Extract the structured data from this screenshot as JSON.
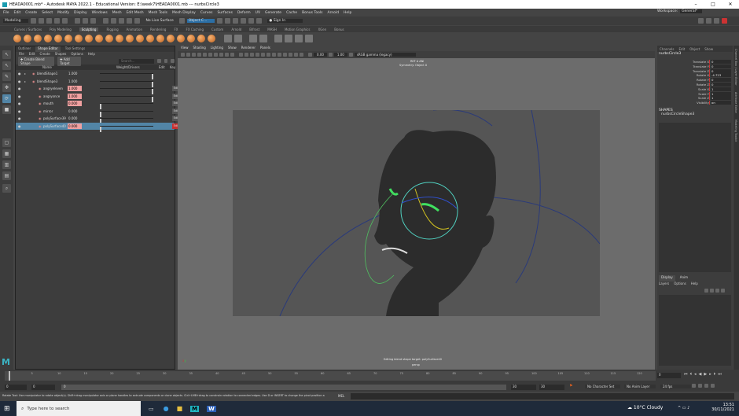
{
  "title": "HEADA0001.mb* - Autodesk MAYA 2022.1 - Educational Version: E:\\week7\\HEADA0001.mb  ---  nurbsCircle3",
  "window_controls": [
    "–",
    "□",
    "✕"
  ],
  "menubar": [
    "File",
    "Edit",
    "Create",
    "Select",
    "Modify",
    "Display",
    "Windows",
    "Mesh",
    "Edit Mesh",
    "Mesh Tools",
    "Mesh Display",
    "Curves",
    "Surfaces",
    "Deform",
    "UV",
    "Generate",
    "Cache",
    "Bonus Tools",
    "Arnold",
    "Help"
  ],
  "workspace": {
    "label": "Workspace:",
    "value": "General*"
  },
  "statusline": {
    "mode": "Modeling",
    "live": "No Live Surface",
    "object": "Object C...",
    "sign_in": "Sign In"
  },
  "shelf_tabs": [
    "Curves / Surfaces",
    "Poly Modeling",
    "Sculpting",
    "Rigging",
    "Animation",
    "Rendering",
    "FX",
    "FX Caching",
    "Custom",
    "Arnold",
    "Bifrost",
    "MASH",
    "Motion Graphics",
    "XGen",
    "Bonus"
  ],
  "shelf_active": "Sculpting",
  "panel_tabs": [
    "Outliner",
    "Shape Editor",
    "Tool Settings"
  ],
  "panel_menu": [
    "File",
    "Edit",
    "Create",
    "Shapes",
    "Options",
    "Help"
  ],
  "shape_editor": {
    "create_btn": "Create Blend Shape",
    "add_btn": "Add Target",
    "search_placeholder": "Search...",
    "cols": {
      "name": "Name",
      "weight": "Weight/Drivers",
      "edit": "Edit",
      "key": "Key"
    },
    "rows": [
      {
        "name": "blendShape1",
        "value": "1.000",
        "indent": 0,
        "style": "plain",
        "handle_fraction": 1.0,
        "edit": "",
        "sel": false,
        "key": false
      },
      {
        "name": "blendShape3",
        "value": "1.000",
        "indent": 0,
        "style": "plain",
        "handle_fraction": 1.0,
        "edit": "",
        "sel": false,
        "key": false
      },
      {
        "name": "angryeleven",
        "value": "1.000",
        "indent": 1,
        "style": "red",
        "handle_fraction": 1.0,
        "edit": "Edit",
        "sel": false,
        "key": true
      },
      {
        "name": "angryonce",
        "value": "1.000",
        "indent": 1,
        "style": "red",
        "handle_fraction": 1.0,
        "edit": "Edit",
        "sel": false,
        "key": true
      },
      {
        "name": "mouth",
        "value": "0.000",
        "indent": 1,
        "style": "red",
        "handle_fraction": 0.0,
        "edit": "Edit",
        "sel": false,
        "key": true
      },
      {
        "name": "mirror",
        "value": "0.000",
        "indent": 1,
        "style": "plain",
        "handle_fraction": 0.0,
        "edit": "Edit",
        "sel": false,
        "key": false
      },
      {
        "name": "polySurface39",
        "value": "0.000",
        "indent": 1,
        "style": "plain",
        "handle_fraction": 0.0,
        "edit": "Edit",
        "sel": false,
        "key": false
      },
      {
        "name": "polySurface40",
        "value": "0.000",
        "indent": 1,
        "style": "red",
        "handle_fraction": 0.0,
        "edit": "Edit",
        "sel": true,
        "key": true
      }
    ]
  },
  "viewport": {
    "menu": [
      "View",
      "Shading",
      "Lighting",
      "Show",
      "Renderer",
      "Panels"
    ],
    "value1": "0.00",
    "value2": "1.00",
    "colorspace": "sRGB gamma (legacy)",
    "hud_top1": "REF A ANI",
    "hud_top2": "Symmetry: Object X",
    "hud_msg": "Editing blend shape target: polySurface40",
    "hud_cam": "persp"
  },
  "channel_box": {
    "tabs": [
      "Channels",
      "Edit",
      "Object",
      "Show"
    ],
    "object": "nurbsCircle3",
    "attrs": [
      {
        "name": "Translate X",
        "value": "0"
      },
      {
        "name": "Translate Y",
        "value": "0"
      },
      {
        "name": "Translate Z",
        "value": "0"
      },
      {
        "name": "Rotate X",
        "value": "-4.723"
      },
      {
        "name": "Rotate Y",
        "value": "0"
      },
      {
        "name": "Rotate Z",
        "value": "0"
      },
      {
        "name": "Scale X",
        "value": "1"
      },
      {
        "name": "Scale Y",
        "value": "1"
      },
      {
        "name": "Scale Z",
        "value": "1"
      },
      {
        "name": "Visibility",
        "value": "on"
      }
    ],
    "shapes_label": "SHAPES",
    "shape_name": "nurbsCircleShape3",
    "layer_tabs": [
      "Display",
      "Anim"
    ],
    "layer_menu": [
      "Layers",
      "Options",
      "Help"
    ]
  },
  "right_strip_labels": [
    "Channel Box / Layer Editor",
    "Attribute Editor",
    "Modeling Toolkit"
  ],
  "timeline": {
    "ticks": [
      "5",
      "10",
      "15",
      "20",
      "25",
      "30",
      "35",
      "40",
      "45",
      "50",
      "55",
      "60",
      "65",
      "70",
      "75",
      "80",
      "85",
      "90",
      "95",
      "100",
      "105",
      "110",
      "115",
      "120"
    ],
    "current_frame": "0",
    "frame_field": "0"
  },
  "rangebar": {
    "start": "0",
    "start2": "0",
    "end": "30",
    "end2": "30",
    "current": "0",
    "character": "No Character Set",
    "anim_layer": "No Anim Layer",
    "fps": "24 fps"
  },
  "cmdline": {
    "lang": "MEL",
    "help": "Rotate Tool: Use manipulator to rotate object(s). Shift+drag manipulator axis or plane handles to extrude components or clone objects. Ctrl+LMB+drag to constrain rotation to connected edges. Use D or INSERT to change the pivot position and axis orientation."
  },
  "taskbar": {
    "search": "Type here to search",
    "weather": "10°C  Cloudy",
    "time": "13:51",
    "date": "30/11/2021"
  }
}
